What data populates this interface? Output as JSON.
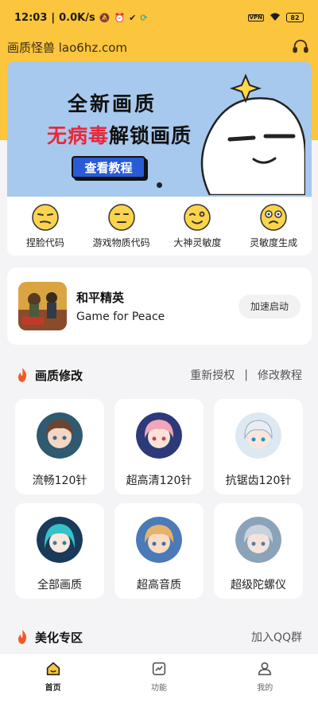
{
  "status_bar": {
    "time": "12:03",
    "speed": "0.0K/s",
    "battery": "82",
    "vpn_label": "VPN"
  },
  "header": {
    "title": "画质怪兽 lao6hz.com"
  },
  "banner": {
    "line1": "全新画质",
    "line2_red": "无病毒",
    "line2_dark": "解锁画质",
    "cta_label": "查看教程"
  },
  "quick_actions": [
    {
      "label": "捏脸代码",
      "icon": "smirk-face-icon"
    },
    {
      "label": "游戏物质代码",
      "icon": "neutral-face-icon"
    },
    {
      "label": "大神灵敏度",
      "icon": "wink-face-icon"
    },
    {
      "label": "灵敏度生成",
      "icon": "dizzy-face-icon"
    }
  ],
  "game": {
    "name_cn": "和平精英",
    "name_en": "Game for Peace",
    "boost_label": "加速启动"
  },
  "quality_section": {
    "title": "画质修改",
    "link1": "重新授权",
    "separator": "|",
    "link2": "修改教程",
    "cards": [
      {
        "label": "流畅120针"
      },
      {
        "label": "超高清120针"
      },
      {
        "label": "抗锯齿120针"
      },
      {
        "label": "全部画质"
      },
      {
        "label": "超高音质"
      },
      {
        "label": "超级陀螺仪"
      }
    ]
  },
  "beautify_section": {
    "title": "美化专区",
    "link": "加入QQ群"
  },
  "tabs": [
    {
      "label": "首页",
      "active": true
    },
    {
      "label": "功能",
      "active": false
    },
    {
      "label": "我的",
      "active": false
    }
  ],
  "colors": {
    "accent": "#fbc53e",
    "banner_bg": "#a8c9ee",
    "cta_blue": "#2a5bd7",
    "banner_red": "#e8283c"
  }
}
